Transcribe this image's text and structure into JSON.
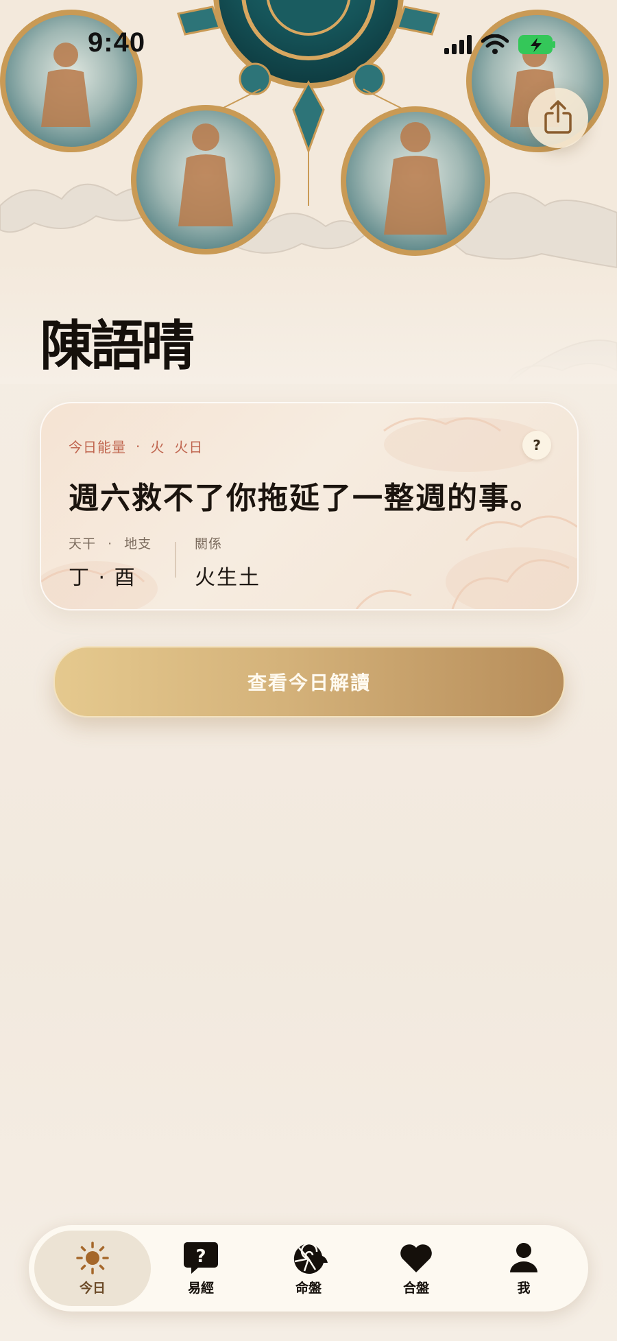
{
  "status_bar": {
    "time": "9:40"
  },
  "user": {
    "name": "陳語晴"
  },
  "energy_card": {
    "header_label": "今日能量",
    "header_separator": "·",
    "element": "火",
    "day_element": "火日",
    "help_label": "?",
    "quote": "週六救不了你拖延了一整週的事。",
    "stem_label": "天干",
    "stem_separator": "·",
    "branch_label": "地支",
    "stem_branch_value": "丁 · 酉",
    "relation_label": "關係",
    "relation_value": "火生土"
  },
  "cta": {
    "label": "查看今日解讀"
  },
  "tabbar": {
    "items": [
      {
        "label": "今日",
        "icon": "sun-icon",
        "active": true
      },
      {
        "label": "易經",
        "icon": "question-bubble-icon",
        "active": false
      },
      {
        "label": "命盤",
        "icon": "nautilus-icon",
        "active": false
      },
      {
        "label": "合盤",
        "icon": "heart-icon",
        "active": false
      },
      {
        "label": "我",
        "icon": "person-icon",
        "active": false
      }
    ]
  },
  "colors": {
    "accent_gold": "#c9a36a",
    "accent_red": "#c0654f",
    "text_dark": "#1e1813",
    "active_tab": "#ece3d4"
  }
}
